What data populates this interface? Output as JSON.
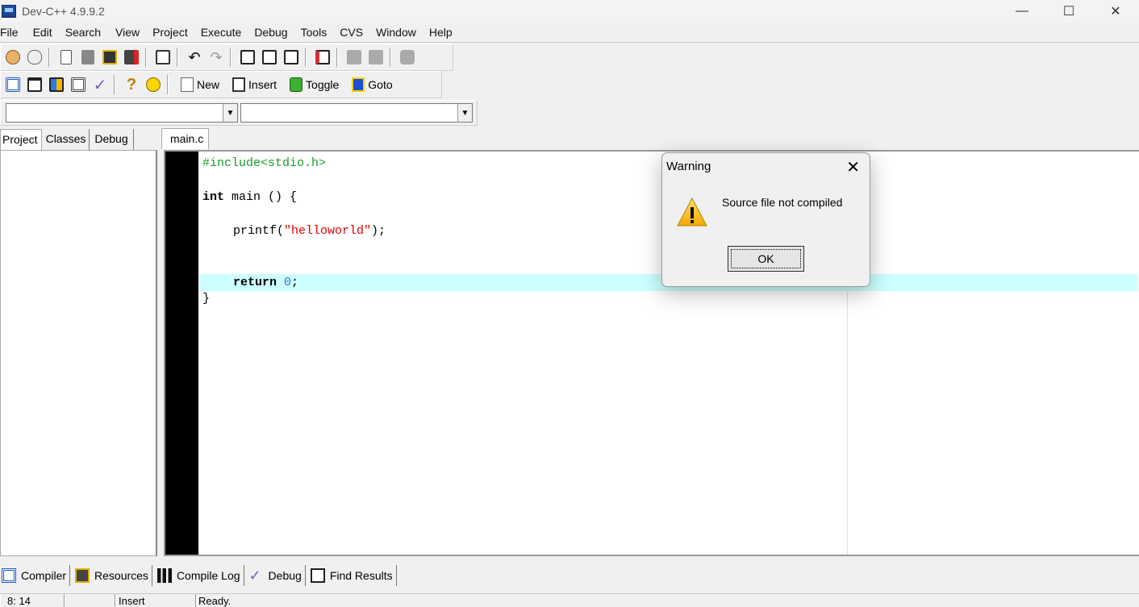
{
  "window": {
    "title": "Dev-C++ 4.9.9.2",
    "controls": [
      "minimize-icon",
      "maximize-icon",
      "close-icon"
    ]
  },
  "menu": [
    "File",
    "Edit",
    "Search",
    "View",
    "Project",
    "Execute",
    "Debug",
    "Tools",
    "CVS",
    "Window",
    "Help"
  ],
  "toolbar": {
    "row1_icons": [
      "open-project-icon",
      "open-file-icon",
      "new-file-icon",
      "save-icon",
      "save-all-icon",
      "close-file-icon",
      "print-icon",
      "undo-icon",
      "redo-icon",
      "find-icon",
      "replace-icon",
      "find-next-icon",
      "goto-line-icon",
      "prev-icon",
      "next-icon",
      "fullscreen-icon"
    ],
    "row2_icons": [
      "compile-icon",
      "run-icon",
      "compile-run-icon",
      "rebuild-icon",
      "debug-check-icon",
      "help-icon",
      "about-icon"
    ],
    "new_label": "New",
    "insert_label": "Insert",
    "toggle_label": "Toggle",
    "goto_label": "Goto"
  },
  "side_tabs": [
    "Project",
    "Classes",
    "Debug"
  ],
  "editor": {
    "file_tab": "main.c",
    "lines": {
      "l1": "#include<stdio.h>",
      "l2_kw": "int",
      "l2_rest": " main () {",
      "l3_fn": "printf(",
      "l3_str": "\"helloworld\"",
      "l3_end": ");",
      "l5_kw": "return",
      "l5_num": "0",
      "l5_end": ";",
      "l6": "}"
    }
  },
  "bottom_tabs": [
    "Compiler",
    "Resources",
    "Compile Log",
    "Debug",
    "Find Results"
  ],
  "status": {
    "position": "8: 14",
    "modified": "",
    "mode": "Insert",
    "message": "Ready."
  },
  "dialog": {
    "title": "Warning",
    "message": "Source file not compiled",
    "ok_label": "OK",
    "icon": "warning-icon"
  },
  "colors": {
    "preprocessor": "#1a9c2a",
    "string": "#e20000",
    "number": "#3b6fd3",
    "current_line": "#ccffff"
  }
}
